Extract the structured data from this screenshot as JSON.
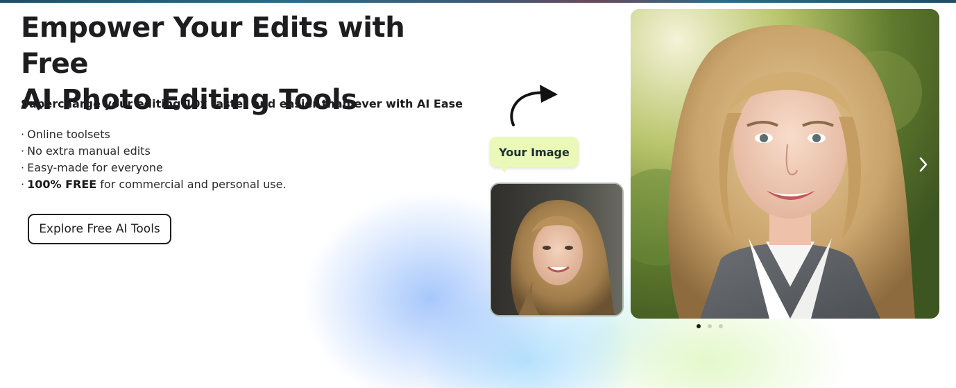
{
  "hero": {
    "title_line1": "Empower Your Edits with Free",
    "title_line2": "AI Photo Editing Tools",
    "subtitle": "Supercharge your editing 10x faster and easier than ever with AI Ease",
    "features": [
      {
        "bullet": "·",
        "text": "Online toolsets"
      },
      {
        "bullet": "·",
        "text": "No extra manual edits"
      },
      {
        "bullet": "·",
        "text": "Easy-made for everyone"
      },
      {
        "bullet": "·",
        "bold": "100% FREE",
        "text": " for commercial and personal use."
      }
    ],
    "cta_label": "Explore Free AI Tools"
  },
  "demo": {
    "bubble_label": "Your Image",
    "arrow_icon": "curved-arrow-icon",
    "next_icon": "chevron-right-icon",
    "carousel_dots": 3,
    "active_dot": 0
  },
  "colors": {
    "bubble_bg": "#eaf8b8",
    "text_dark": "#1d1d1f",
    "dot_active": "#1a1a1a",
    "dot_inactive": "#c9ccc7"
  }
}
